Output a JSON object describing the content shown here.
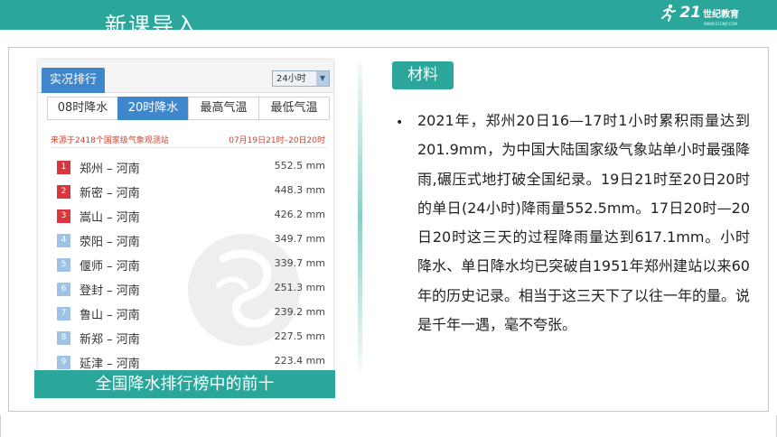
{
  "header": {
    "title": "新课导入",
    "logo_number": "21",
    "logo_text": "世纪教育",
    "logo_sub": "WWW.21CNJY.COM"
  },
  "ranking": {
    "tab_label": "实况排行",
    "period_select": "24小时",
    "subtabs": [
      "08时降水",
      "20时降水",
      "最高气温",
      "最低气温"
    ],
    "active_subtab": 1,
    "source": "来源于2418个国家级气象观测站",
    "date_range": "07月19日21时–20日20时",
    "rows": [
      {
        "rank": "1",
        "station": "郑州 – 河南",
        "value": "552.5 mm"
      },
      {
        "rank": "2",
        "station": "新密 – 河南",
        "value": "448.3 mm"
      },
      {
        "rank": "3",
        "station": "嵩山 – 河南",
        "value": "426.2 mm"
      },
      {
        "rank": "4",
        "station": "荥阳 – 河南",
        "value": "349.7 mm"
      },
      {
        "rank": "5",
        "station": "偃师 – 河南",
        "value": "339.7 mm"
      },
      {
        "rank": "6",
        "station": "登封 – 河南",
        "value": "251.3 mm"
      },
      {
        "rank": "7",
        "station": "鲁山 – 河南",
        "value": "239.2 mm"
      },
      {
        "rank": "8",
        "station": "新郑 – 河南",
        "value": "227.5 mm"
      },
      {
        "rank": "9",
        "station": "延津 – 河南",
        "value": "223.4 mm"
      }
    ]
  },
  "caption": "全国降水排行榜中的前十",
  "material": {
    "label": "材料",
    "bullet": "•",
    "text": "2021年，郑州20日16—17时1小时累积雨量达到201.9mm，为中国大陆国家级气象站单小时最强降雨,碾压式地打破全国纪录。19日21时至20日20时的单日(24小时)降雨量552.5mm。17日20时—20日20时这三天的过程降雨量达到617.1mm。小时降水、单日降水均已突破自1951年郑州建站以来60年的历史记录。相当于这三天下了以往一年的量。说是千年一遇，毫不夸张。"
  },
  "colors": {
    "accent": "#2ba69a",
    "tab_blue": "#3f87cc",
    "top_rank_red": "#d9363e",
    "rank_blue": "#9dc3e6"
  }
}
